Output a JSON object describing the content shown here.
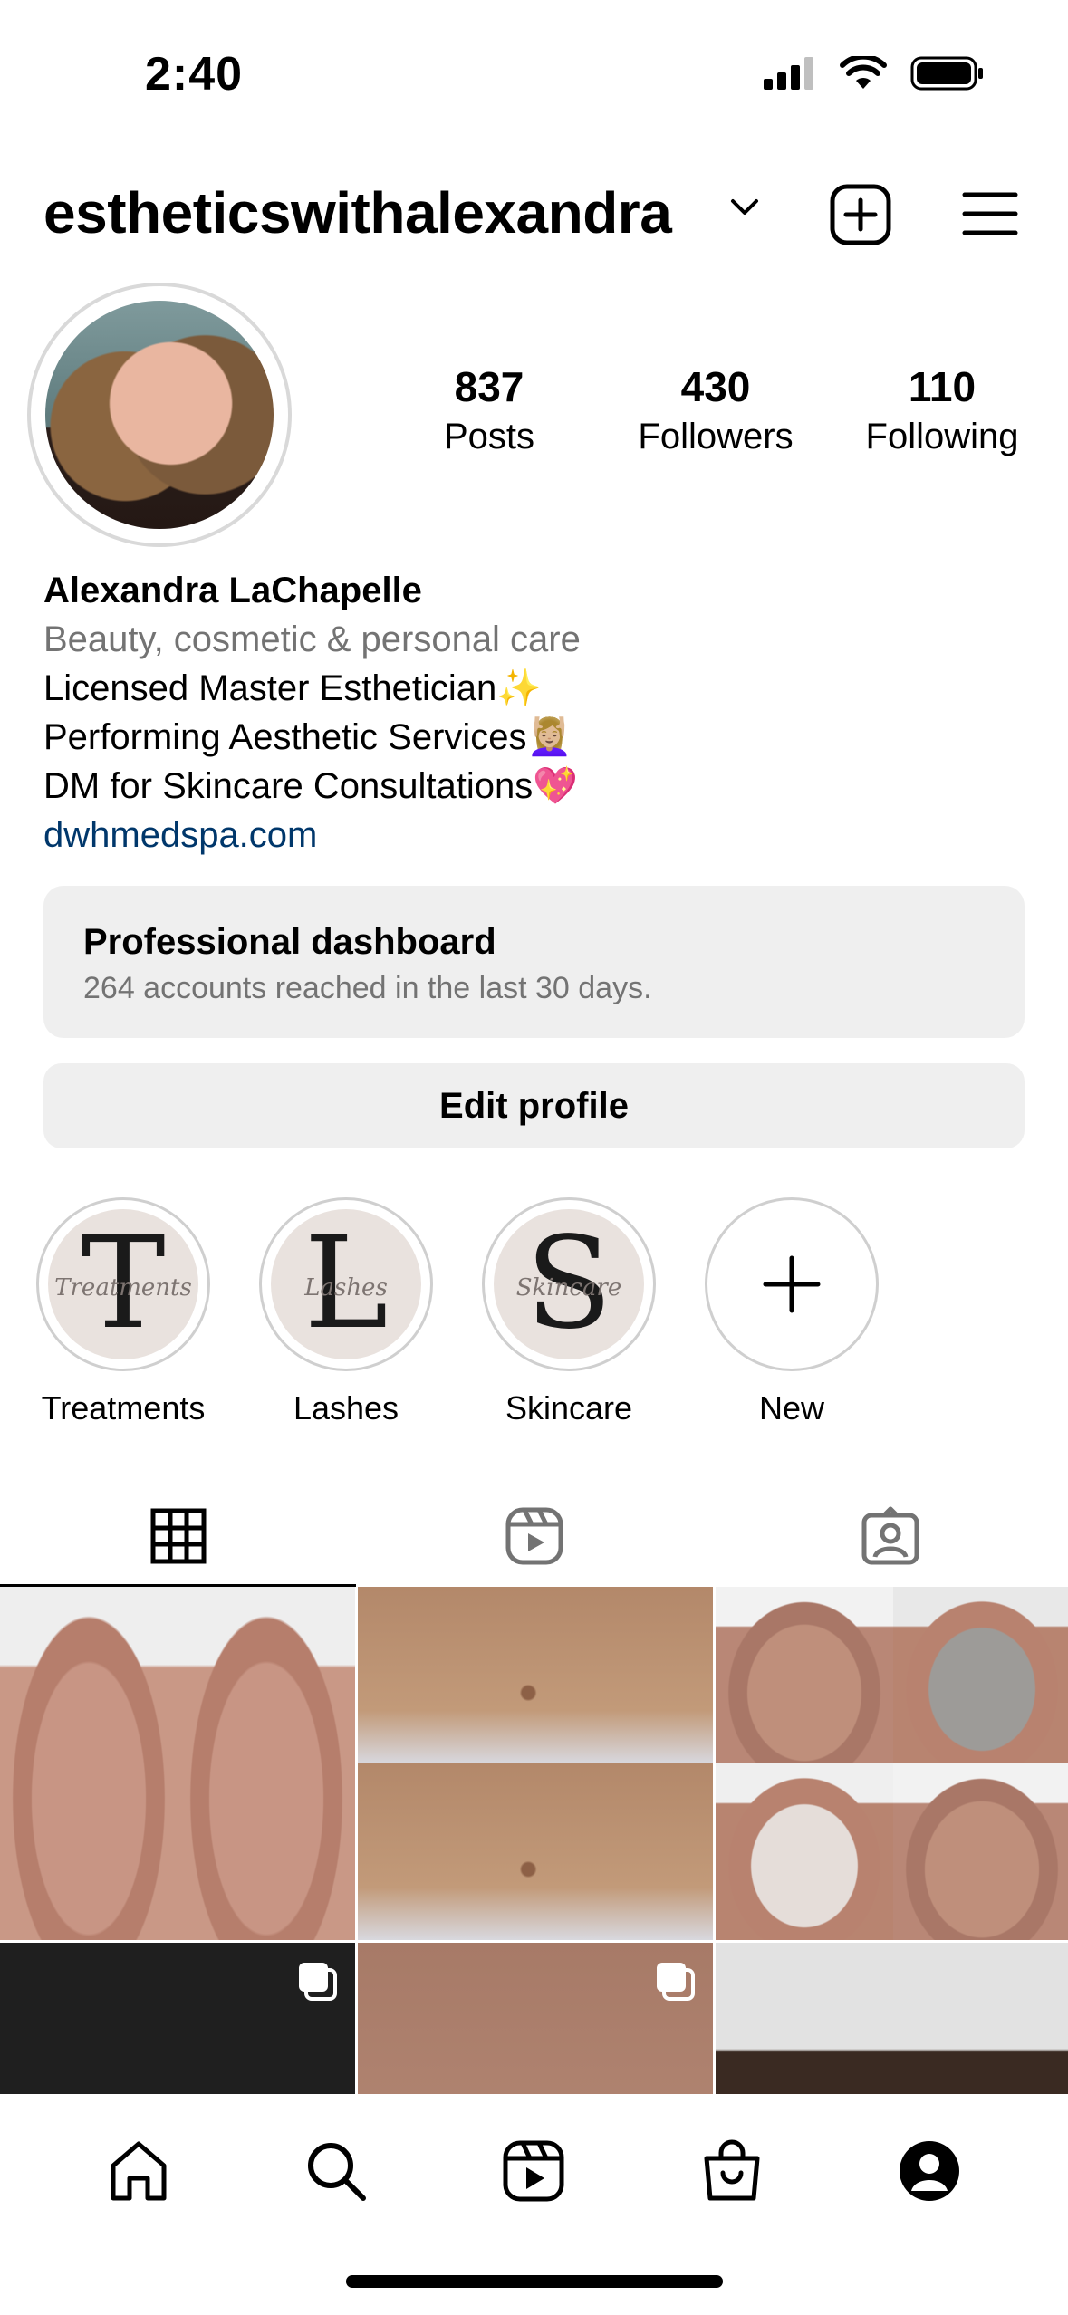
{
  "status_bar": {
    "time": "2:40"
  },
  "header": {
    "username": "estheticswithalexandra"
  },
  "profile": {
    "stats": [
      {
        "value": "837",
        "label": "Posts"
      },
      {
        "value": "430",
        "label": "Followers"
      },
      {
        "value": "110",
        "label": "Following"
      }
    ],
    "name": "Alexandra LaChapelle",
    "category": "Beauty, cosmetic & personal care",
    "bio_lines": [
      "Licensed Master Esthetician✨",
      "Performing Aesthetic Services💆🏼‍♀️",
      "DM for Skincare Consultations💖"
    ],
    "link": "dwhmedspa.com"
  },
  "dashboard": {
    "title": "Professional dashboard",
    "subtitle": "264 accounts reached in the last 30 days."
  },
  "edit_profile_label": "Edit profile",
  "highlights": [
    {
      "label": "Treatments",
      "letter": "T",
      "script": "Treatments"
    },
    {
      "label": "Lashes",
      "letter": "L",
      "script": "Lashes"
    },
    {
      "label": "Skincare",
      "letter": "S",
      "script": "Skincare"
    },
    {
      "label": "New"
    }
  ],
  "tabs": [
    "grid-icon",
    "reels-icon",
    "tagged-icon"
  ],
  "bottom_nav": [
    "home-icon",
    "search-icon",
    "reels-icon",
    "shop-icon",
    "profile-icon"
  ]
}
